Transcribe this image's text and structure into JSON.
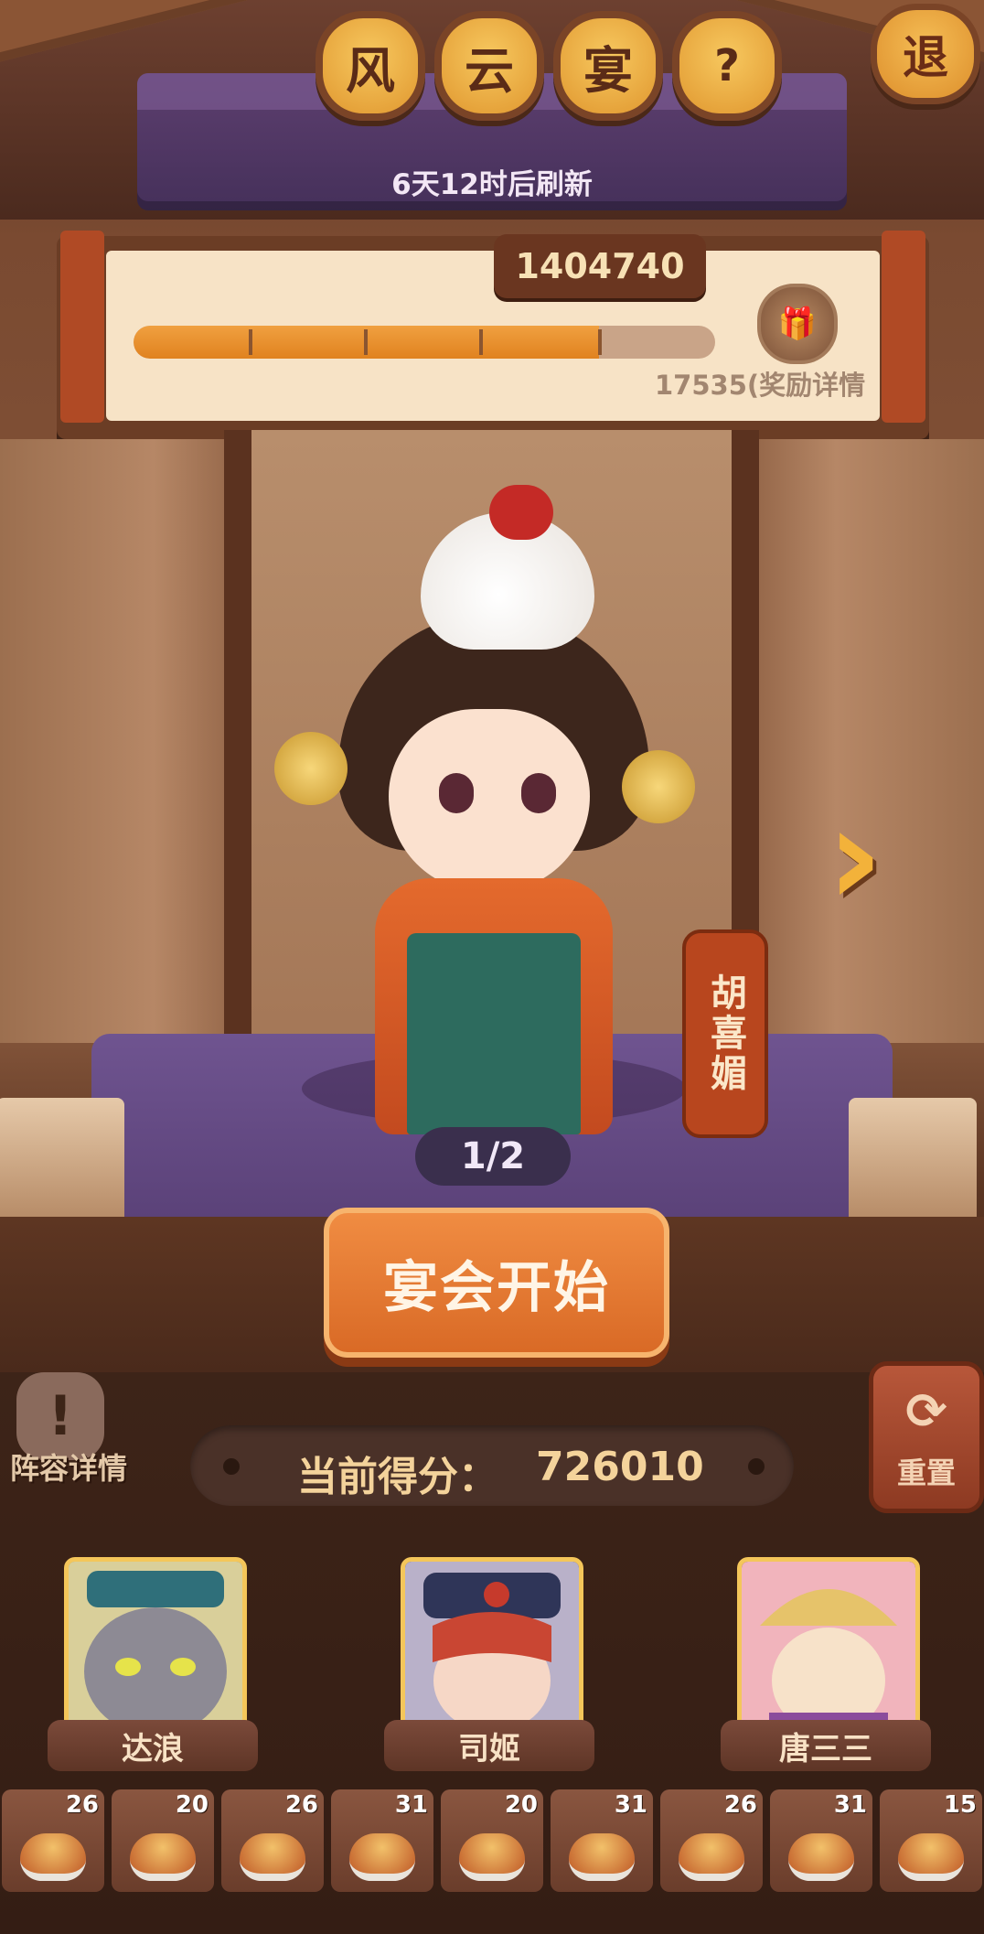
{
  "header": {
    "title_chars": [
      "风",
      "云",
      "宴"
    ],
    "help_icon": "?",
    "exit_label": "退",
    "refresh_text": "6天12时后刷新"
  },
  "progress": {
    "current_score": "1404740",
    "target_text": "17535(",
    "reward_details": "奖励详情",
    "fill_fraction": 0.8
  },
  "character": {
    "name": "胡喜媚",
    "page_indicator": "1/2"
  },
  "actions": {
    "start_label": "宴会开始",
    "lineup_details": "阵容详情",
    "reset_label": "重置"
  },
  "score": {
    "label": "当前得分：",
    "value": "726010"
  },
  "heroes": [
    {
      "name": "达浪"
    },
    {
      "name": "司姬"
    },
    {
      "name": "唐三三"
    }
  ],
  "dishes": [
    {
      "count": "26"
    },
    {
      "count": "20"
    },
    {
      "count": "26"
    },
    {
      "count": "31"
    },
    {
      "count": "20"
    },
    {
      "count": "31"
    },
    {
      "count": "26"
    },
    {
      "count": "31"
    },
    {
      "count": "15"
    }
  ],
  "icons": {
    "next": "chevron-right-icon",
    "reset": "refresh-icon",
    "detail": "exclamation-icon",
    "reward": "gift-icon"
  }
}
